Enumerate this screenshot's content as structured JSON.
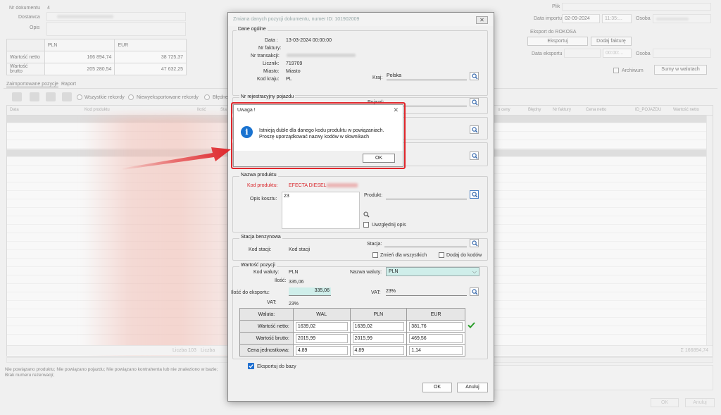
{
  "main": {
    "header": {
      "nr_dokumentu_label": "Nr dokumentu",
      "nr_dokumentu_value": "4",
      "dostawca_label": "Dostawca",
      "opis_label": "Opis"
    },
    "values_table": {
      "col_pln": "PLN",
      "col_eur": "EUR",
      "netto_label": "Wartość netto",
      "netto_pln": "166 894,74",
      "netto_eur": "38 725,37",
      "brutto_label": "Wartość brutto",
      "brutto_pln": "205 280,54",
      "brutto_eur": "47 632,25"
    },
    "right_panel": {
      "plik_label": "Plik",
      "data_importu_label": "Data importu",
      "data_importu_value": "02-09-2024",
      "time_value": "11:35:...",
      "osoba_label": "Osoba",
      "eksport_title": "Eksport do ROKOSA",
      "eksportuj_button": "Eksportuj",
      "dodaj_fakture_button": "Dodaj fakturę",
      "data_eksportu_label": "Data eksportu",
      "time2_value": "00:00:...",
      "osoba2_label": "Osoba",
      "archiwum_label": "Archiwum",
      "sumy_button": "Sumy w walutach"
    },
    "tabs": [
      "Zaimportowane pozycje",
      "Raport"
    ],
    "filters": {
      "all": "Wszystkie rekordy",
      "not_exported": "Niewyeksportowane rekordy",
      "errors": "Błędne"
    },
    "grid": {
      "headers_left": [
        "Data",
        "Kod produktu",
        "Ilość",
        "Sta"
      ],
      "headers_right": [
        "o ceny",
        "Błędny",
        "Nr faktury",
        "Cena netto",
        "ID_POJAZDU",
        "Wartość netto"
      ],
      "footer_left": "Liczba 103",
      "footer_left2": "Liczba",
      "footer_right": "Σ 166894,74"
    },
    "status_text_1": "Nie powiązano produktu; Nie powiązano pojazdu; Nie powiązano kontrahenta lub nie znaleziono w bazie;",
    "status_text_2": "Brak numeru rezerwacji;",
    "ok_button": "OK",
    "anuluj_button": "Anuluj"
  },
  "dialog": {
    "title": "Zmiana danych pozycji dokumentu, numer ID: 101902009",
    "close": "✕",
    "dane_ogolne": {
      "title": "Dane ogólne",
      "data_label": "Data :",
      "data_value": "13-03-2024 00:00:00",
      "nr_faktury_label": "Nr faktury:",
      "nr_transakcji_label": "Nr transakcji:",
      "licznik_label": "Licznik:",
      "licznik_value": "719709",
      "miasto_label": "Miasto:",
      "miasto_value": "Miasto",
      "kod_kraju_label": "Kod kraju:",
      "kod_kraju_value": "PL",
      "kraj_label": "Kraj:",
      "kraj_value": "Polska"
    },
    "nr_rej_title": "Nr rejestracyjny pojazdu",
    "pojazd_label": "Pojazd:",
    "nazwa_produktu": {
      "title": "Nazwa produktu",
      "kod_produktu_label": "Kod produktu:",
      "kod_produktu_value": "EFECTA DIESEL",
      "produkt_label": "Produkt:",
      "opis_kosztu_label": "Opis kosztu:",
      "opis_kosztu_value": "23",
      "uwzglednij_opis": "Uwzględnij opis"
    },
    "stacja": {
      "title": "Stacja benzynowa",
      "kod_stacji_label": "Kod stacji:",
      "kod_stacji_value": "Kod stacji",
      "stacja_label": "Stacja:",
      "zmien_dla_wszystkich": "Zmień dla wszystkich",
      "dodaj_do_kodow": "Dodaj do kodów"
    },
    "wartosc": {
      "title": "Wartość pozycji",
      "kod_waluty_label": "Kod waluty:",
      "kod_waluty_value": "PLN",
      "nazwa_waluty_label": "Nazwa waluty:",
      "nazwa_waluty_value": "PLN",
      "ilosc_label": "Ilość:",
      "ilosc_value": "335,06",
      "ilosc_eksport_label": "Ilość do eksportu:",
      "ilosc_eksport_value": "335,06",
      "vat_label": "VAT:",
      "vat_value": "23%",
      "vat2_label": "VAT:",
      "vat2_value": "23%"
    },
    "currency_table": {
      "headers": [
        "Waluta:",
        "WAL",
        "PLN",
        "EUR"
      ],
      "rows": [
        {
          "label": "Wartość netto:",
          "wal": "1639,02",
          "pln": "1639,02",
          "eur": "381,76"
        },
        {
          "label": "Wartość brutto:",
          "wal": "2015,99",
          "pln": "2015,99",
          "eur": "469,56"
        },
        {
          "label": "Cena jednostkowa:",
          "wal": "4,89",
          "pln": "4,89",
          "eur": "1,14"
        }
      ]
    },
    "eksportuj_do_bazy": "Eksportuj do bazy",
    "ok_button": "OK",
    "anuluj_button": "Anuluj"
  },
  "alert": {
    "title": "Uwaga !",
    "close": "✕",
    "message_line1": "Istnieją duble dla danego kodu produktu w powiązaniach.",
    "message_line2": "Proszę uporządkować nazwy kodów w słownikach",
    "ok_button": "OK"
  },
  "colors": {
    "annotation_red": "#e0262b",
    "info_blue": "#1a73d0",
    "check_green": "#2a9d2a",
    "product_code_red": "#d9252a",
    "ilosc_highlight": "#cfeeea",
    "waluta_highlight": "#cfeeea"
  }
}
